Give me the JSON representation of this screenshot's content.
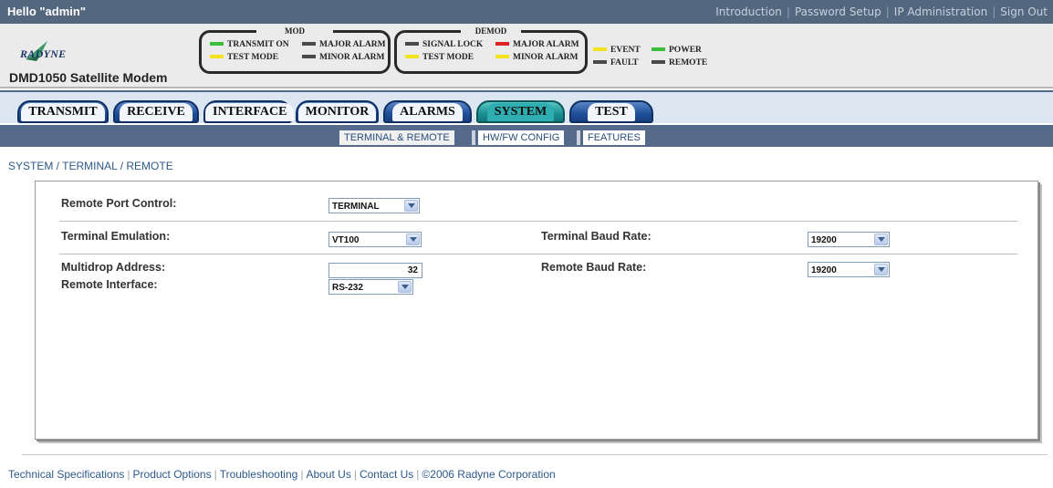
{
  "greeting": "Hello \"admin\"",
  "top_links": [
    "Introduction",
    "Password Setup",
    "IP Administration",
    "Sign Out"
  ],
  "brand": {
    "logo_text": "RADYNE",
    "model": "DMD1050 Satellite Modem"
  },
  "colors": {
    "green": "#3bbf3b",
    "yellow": "#f2e21b",
    "red": "#e02424",
    "dark": "#4a4a4a"
  },
  "led_panel": {
    "mod": {
      "title": "MOD",
      "leds": [
        {
          "label": "TRANSMIT ON",
          "color": "green"
        },
        {
          "label": "MAJOR ALARM",
          "color": "dark"
        },
        {
          "label": "TEST MODE",
          "color": "yellow"
        },
        {
          "label": "MINOR ALARM",
          "color": "dark"
        }
      ]
    },
    "demod": {
      "title": "DEMOD",
      "leds": [
        {
          "label": "SIGNAL LOCK",
          "color": "dark"
        },
        {
          "label": "MAJOR ALARM",
          "color": "red"
        },
        {
          "label": "TEST MODE",
          "color": "yellow"
        },
        {
          "label": "MINOR ALARM",
          "color": "yellow"
        }
      ]
    },
    "status": {
      "leds": [
        {
          "label": "EVENT",
          "color": "yellow"
        },
        {
          "label": "POWER",
          "color": "green"
        },
        {
          "label": "FAULT",
          "color": "dark"
        },
        {
          "label": "REMOTE",
          "color": "dark"
        }
      ]
    }
  },
  "tabs": [
    {
      "label": "TRANSMIT",
      "active": false
    },
    {
      "label": "RECEIVE",
      "active": false
    },
    {
      "label": "INTERFACE",
      "active": false
    },
    {
      "label": "MONITOR",
      "active": false
    },
    {
      "label": "ALARMS",
      "active": false
    },
    {
      "label": "SYSTEM",
      "active": true
    },
    {
      "label": "TEST",
      "active": false
    }
  ],
  "subtabs": [
    {
      "label": "TERMINAL & REMOTE",
      "active": true
    },
    {
      "label": "HW/FW CONFIG",
      "active": false
    },
    {
      "label": "FEATURES",
      "active": false
    }
  ],
  "breadcrumb": "SYSTEM / TERMINAL / REMOTE",
  "form": {
    "remote_port_control": {
      "label": "Remote Port Control:",
      "value": "TERMINAL"
    },
    "terminal_emulation": {
      "label": "Terminal Emulation:",
      "value": "VT100"
    },
    "terminal_baud_rate": {
      "label": "Terminal Baud Rate:",
      "value": "19200"
    },
    "multidrop_address": {
      "label": "Multidrop Address:",
      "value": "32"
    },
    "remote_baud_rate": {
      "label": "Remote Baud Rate:",
      "value": "19200"
    },
    "remote_interface": {
      "label": "Remote Interface:",
      "value": "RS-232"
    }
  },
  "footer_links": [
    "Technical Specifications",
    "Product Options",
    "Troubleshooting",
    "About Us",
    "Contact Us",
    "©2006 Radyne Corporation"
  ]
}
